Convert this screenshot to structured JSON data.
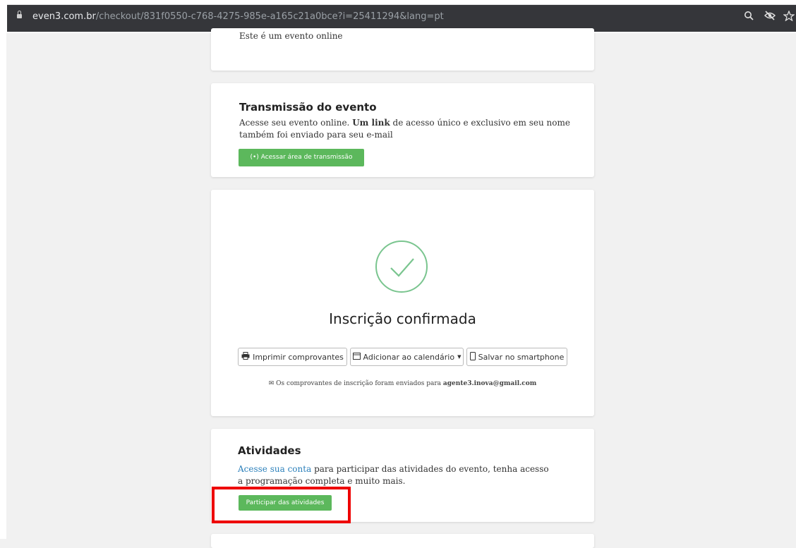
{
  "browser": {
    "url_domain": "even3.com.br",
    "url_path": "/checkout/831f0550-c768-4275-985e-a165c21a0bce?i=25411294&lang=pt"
  },
  "event_card": {
    "text": "Este é um evento online"
  },
  "transmission": {
    "title": "Transmissão do evento",
    "text_pre": "Acesse seu evento online.",
    "text_bold": "Um link",
    "text_post": "de acesso único e exclusivo em seu nome também foi enviado para seu e-mail",
    "button": "Acessar área de transmissão"
  },
  "confirmation": {
    "title": "Inscrição confirmada",
    "buttons": {
      "print": "Imprimir comprovantes",
      "calendar": "Adicionar ao calendário",
      "smartphone": "Salvar no smartphone"
    },
    "note": "Os comprovantes de inscrição foram enviados para",
    "email": "agente3.inova@gmail.com"
  },
  "activities": {
    "title": "Atividades",
    "link": "Acesse sua conta",
    "text": "para participar das atividades do evento, tenha acesso a programação completa e muito mais.",
    "button": "Participar das atividades"
  },
  "colors": {
    "accent_green": "#5cb85c",
    "check_green": "#7ac58f",
    "link": "#2a7fba",
    "highlight": "#ee0000"
  }
}
